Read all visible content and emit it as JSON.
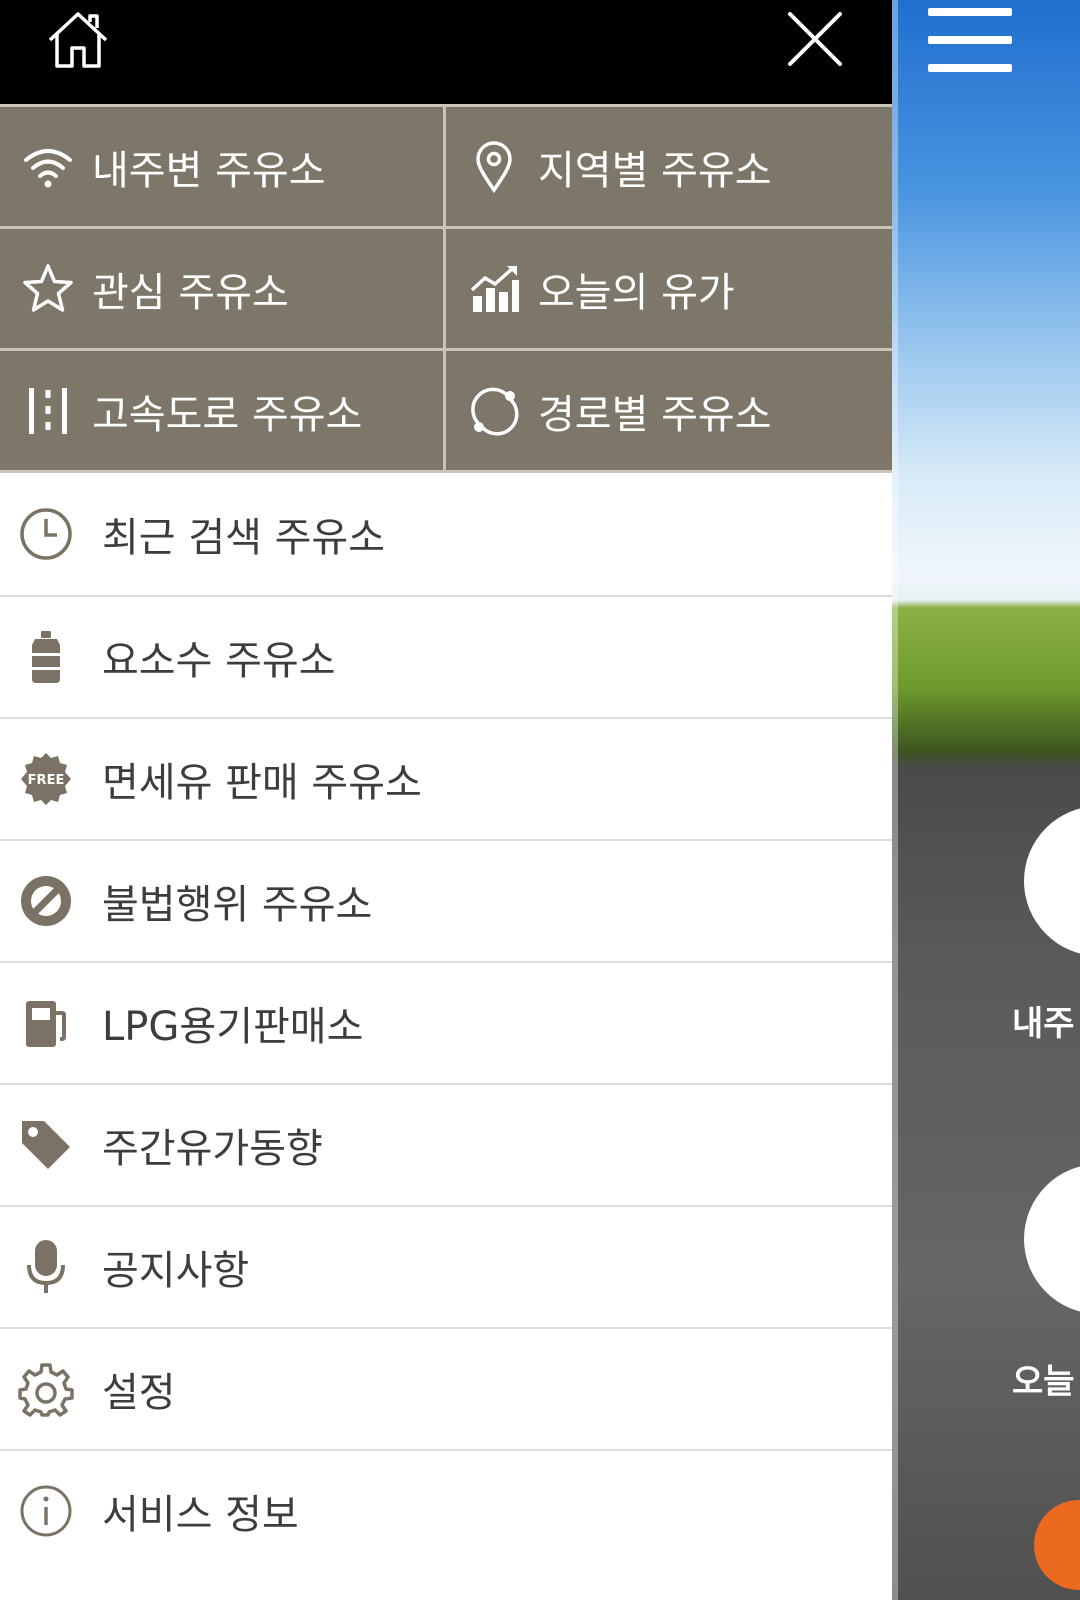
{
  "colors": {
    "accent_brown": "#7d7769",
    "icon_brown": "#7a7264",
    "topbar": "#000000"
  },
  "topbar": {
    "home_icon": "home-icon",
    "close_icon": "close-icon"
  },
  "grid_menu": [
    {
      "label": "내주변 주유소",
      "icon": "wifi-icon"
    },
    {
      "label": "지역별 주유소",
      "icon": "map-pin-icon"
    },
    {
      "label": "관심 주유소",
      "icon": "star-icon"
    },
    {
      "label": "오늘의 유가",
      "icon": "chart-icon"
    },
    {
      "label": "고속도로 주유소",
      "icon": "highway-icon"
    },
    {
      "label": "경로별 주유소",
      "icon": "route-icon"
    }
  ],
  "list_menu": [
    {
      "label": "최근 검색 주유소",
      "icon": "clock-icon"
    },
    {
      "label": "요소수 주유소",
      "icon": "urea-tank-icon"
    },
    {
      "label": "면세유 판매 주유소",
      "icon": "free-badge-icon",
      "badge_text": "FREE"
    },
    {
      "label": "불법행위 주유소",
      "icon": "prohibited-icon"
    },
    {
      "label": "LPG용기판매소",
      "icon": "fuel-pump-icon"
    },
    {
      "label": "주간유가동향",
      "icon": "price-tag-icon"
    },
    {
      "label": "공지사항",
      "icon": "microphone-icon"
    },
    {
      "label": "설정",
      "icon": "gear-icon"
    },
    {
      "label": "서비스 정보",
      "icon": "info-icon"
    }
  ],
  "background": {
    "hamburger_icon": "menu-icon",
    "partial_labels": [
      "내주",
      "오늘"
    ]
  }
}
